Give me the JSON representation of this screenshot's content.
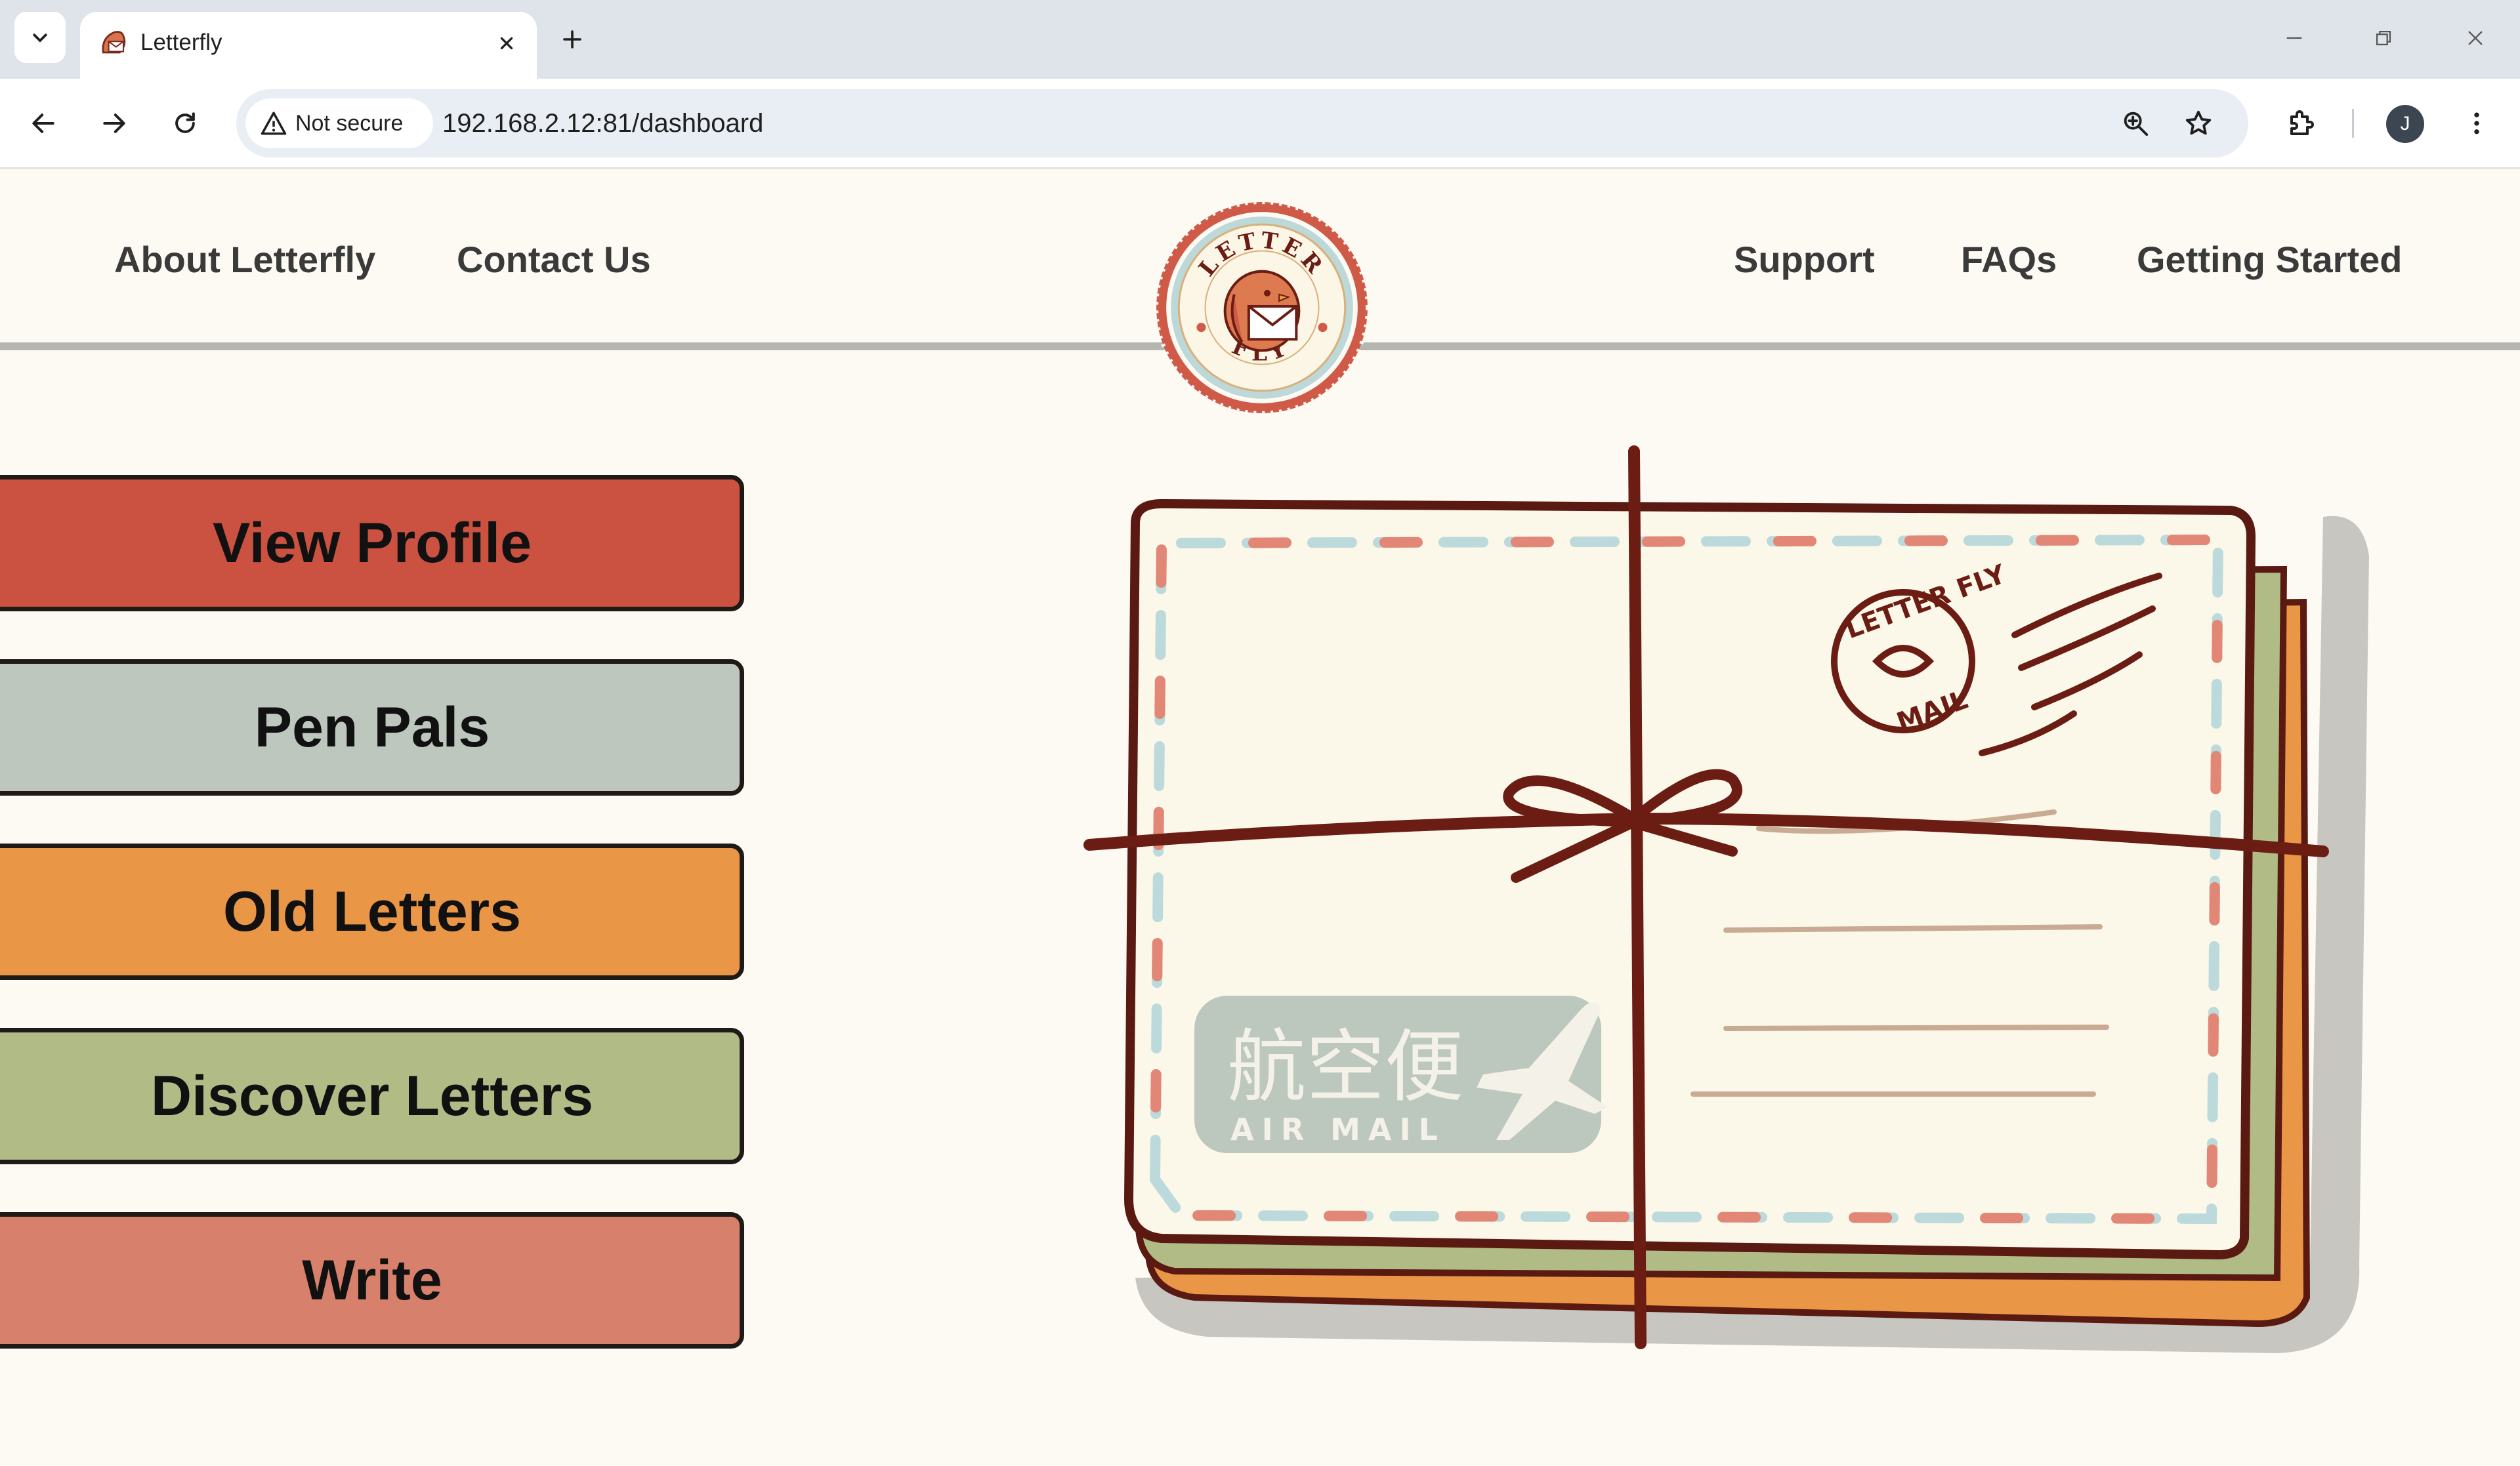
{
  "browser": {
    "tab_title": "Letterfly",
    "security_label": "Not secure",
    "url": "192.168.2.12:81/dashboard",
    "profile_initial": "J"
  },
  "header": {
    "nav_left": [
      "About Letterfly",
      "Contact Us"
    ],
    "nav_right": [
      "Support",
      "FAQs",
      "Getting Started"
    ],
    "logo_letters": "LETTER FLY"
  },
  "menu": {
    "buttons": [
      {
        "label": "View Profile",
        "color": "#cb5140"
      },
      {
        "label": "Pen Pals",
        "color": "#bdc7bd"
      },
      {
        "label": "Old Letters",
        "color": "#e99646"
      },
      {
        "label": "Discover Letters",
        "color": "#b0bb86"
      },
      {
        "label": "Write",
        "color": "#d7806c"
      }
    ]
  },
  "illustration": {
    "stamp_text": "航空便",
    "stamp_subtext": "AIR MAIL",
    "postmark_text": "LETTER FLY MAIL"
  },
  "colors": {
    "page_bg": "#fdfaf3",
    "brown_ink": "#6b1d14",
    "envelope_paper": "#fbf8ea"
  }
}
